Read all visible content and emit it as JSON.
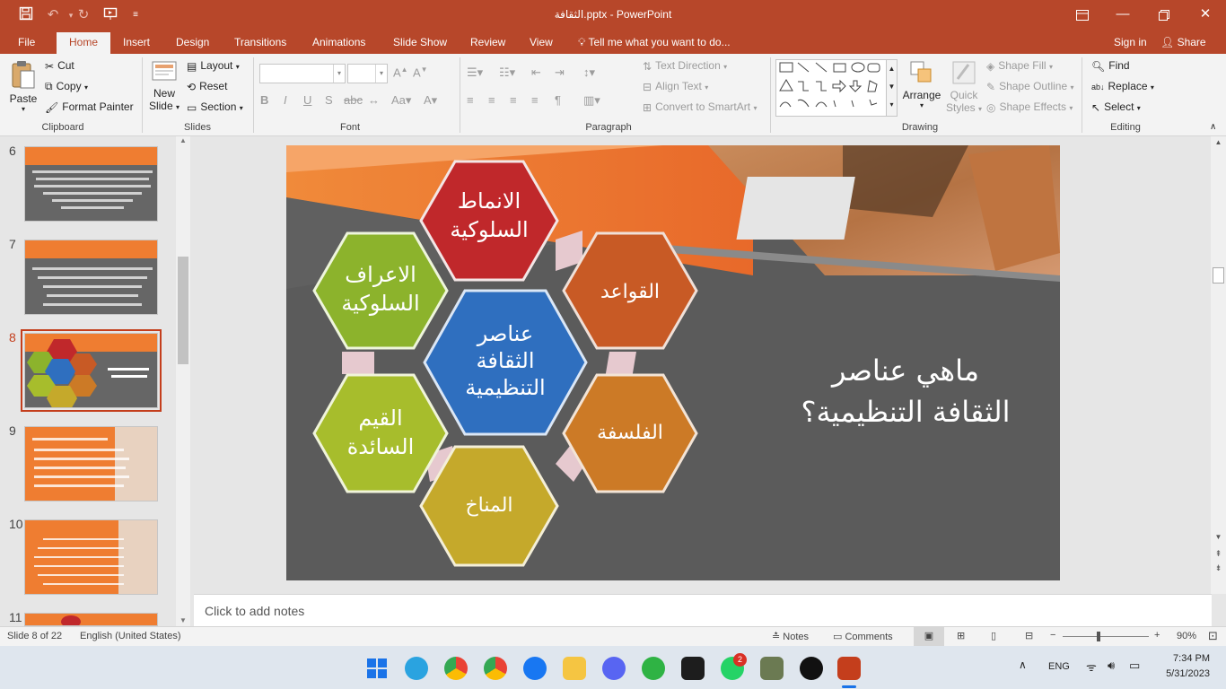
{
  "window": {
    "title": "الثقافة.pptx  -  PowerPoint",
    "search": "Tell me what you want to do...",
    "sign_in": "Sign in",
    "share": "Share"
  },
  "tabs": [
    "File",
    "Home",
    "Insert",
    "Design",
    "Transitions",
    "Animations",
    "Slide Show",
    "Review",
    "View"
  ],
  "active_tab": "Home",
  "ribbon": {
    "clipboard": {
      "label": "Clipboard",
      "paste": "Paste",
      "cut": "Cut",
      "copy": "Copy",
      "format_painter": "Format Painter"
    },
    "slides": {
      "label": "Slides",
      "new_slide_1": "New",
      "new_slide_2": "Slide",
      "layout": "Layout",
      "reset": "Reset",
      "section": "Section"
    },
    "font": {
      "label": "Font",
      "name": "",
      "size": ""
    },
    "paragraph": {
      "label": "Paragraph",
      "text_direction": "Text Direction",
      "align_text": "Align Text",
      "convert_smartart": "Convert to SmartArt"
    },
    "drawing": {
      "label": "Drawing",
      "arrange": "Arrange",
      "quick_styles_1": "Quick",
      "quick_styles_2": "Styles",
      "shape_fill": "Shape Fill",
      "shape_outline": "Shape Outline",
      "shape_effects": "Shape Effects"
    },
    "editing": {
      "label": "Editing",
      "find": "Find",
      "replace": "Replace",
      "select": "Select"
    }
  },
  "thumbnails": [
    {
      "num": "6"
    },
    {
      "num": "7"
    },
    {
      "num": "8"
    },
    {
      "num": "9"
    },
    {
      "num": "10"
    },
    {
      "num": "11"
    }
  ],
  "slide": {
    "title_line1": "ماهي عناصر",
    "title_line2": "الثقافة التنظيمية؟",
    "hexes": {
      "top": [
        "الانماط",
        "السلوكية"
      ],
      "topright": [
        "القواعد"
      ],
      "topleft": [
        "الاعراف",
        "السلوكية"
      ],
      "center": [
        "عناصر",
        "الثقافة",
        "التنظيمية"
      ],
      "bottomright": [
        "الفلسفة"
      ],
      "bottomleft": [
        "القيم",
        "السائدة"
      ],
      "bottom": [
        "المناخ"
      ]
    }
  },
  "notes_placeholder": "Click to add notes",
  "status": {
    "slide_of": "Slide 8 of 22",
    "language": "English (United States)",
    "notes": "Notes",
    "comments": "Comments",
    "zoom": "90%"
  },
  "taskbar": {
    "lang": "ENG",
    "time": "7:34 PM",
    "date": "5/31/2023",
    "badge": "2"
  },
  "colors": {
    "accent": "#b7472a",
    "hex_top": "#c0282b",
    "hex_topright": "#c85a25",
    "hex_topleft": "#8cb32c",
    "hex_center": "#2f6fbf",
    "hex_bottomright": "#cc7a26",
    "hex_bottomleft": "#a7bd2c",
    "hex_bottom": "#c5a92b"
  }
}
